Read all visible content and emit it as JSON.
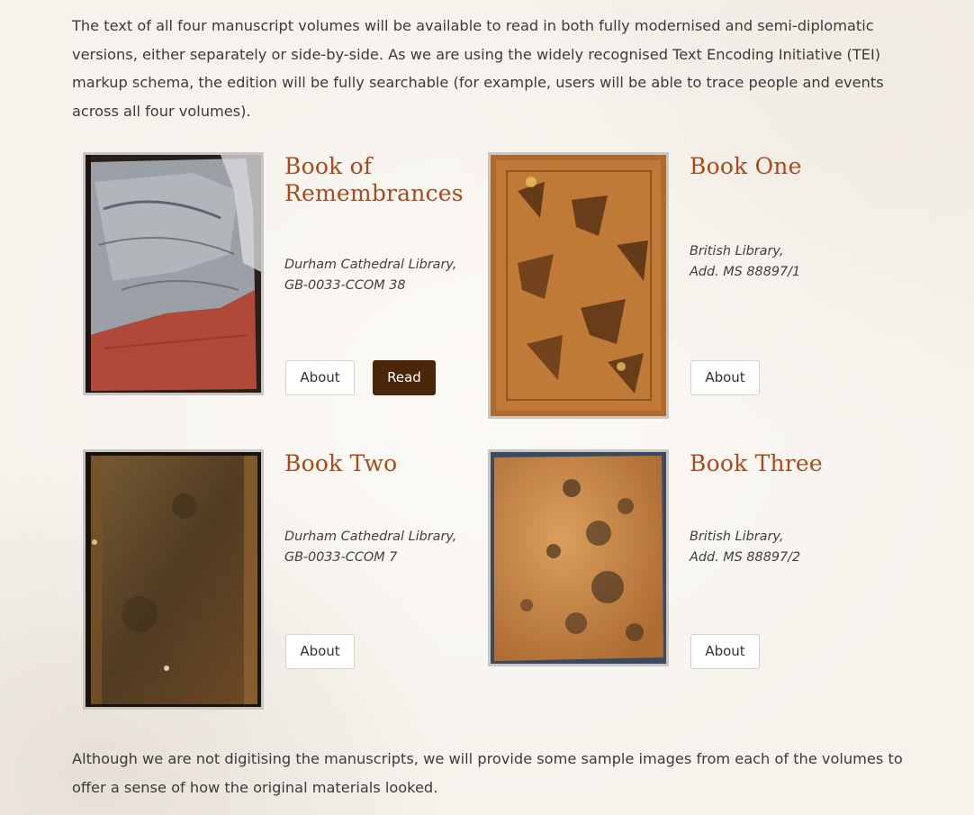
{
  "intro": "The text of all four manuscript volumes will be available to read in both fully modernised and semi-diplomatic versions, either separately or side-by-side. As we are using the widely recognised Text Encoding Initiative (TEI) markup schema, the edition will be fully searchable (for example, users will be able to trace people and events across all four volumes).",
  "books": [
    {
      "title": "Book of Remembrances",
      "repository_line1": "Durham Cathedral Library,",
      "repository_line2": "GB-0033-CCOM 38",
      "about_label": "About",
      "read_label": "Read"
    },
    {
      "title": "Book One",
      "repository_line1": "British Library,",
      "repository_line2": "Add. MS 88897/1",
      "about_label": "About"
    },
    {
      "title": "Book Two",
      "repository_line1": "Durham Cathedral Library,",
      "repository_line2": "GB-0033-CCOM 7",
      "about_label": "About"
    },
    {
      "title": "Book Three",
      "repository_line1": "British Library,",
      "repository_line2": "Add. MS 88897/2",
      "about_label": "About"
    }
  ],
  "outro": "Although we are not digitising the manuscripts, we will provide some sample images from each of the volumes to offer a sense of how the original materials looked.",
  "colors": {
    "title": "#a94a1c",
    "read_button": "#4a2608",
    "body_text": "#3b3b3b",
    "page_background": "#f8f5f0"
  }
}
